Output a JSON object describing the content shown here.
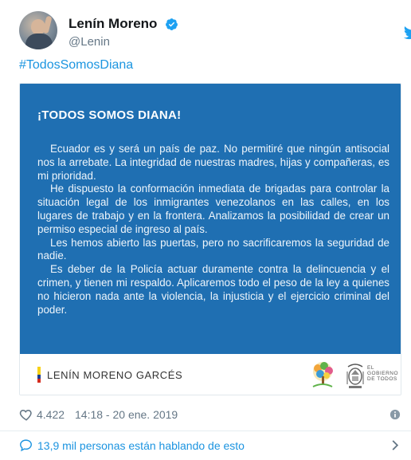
{
  "author": {
    "display_name": "Lenín Moreno",
    "handle": "@Lenin",
    "verified": true
  },
  "tweet": {
    "hashtag": "#TodosSomosDiana"
  },
  "media": {
    "title": "¡TODOS SOMOS DIANA!",
    "paragraphs": [
      "Ecuador es y será un país de paz. No permitiré que ningún antisocial nos la arrebate. La integridad de nuestras madres, hijas y compañeras, es mi prioridad.",
      "He dispuesto la conformación inmediata de brigadas para controlar la situación legal de los inmigrantes venezolanos en las calles, en los lugares de trabajo y en la frontera. Analizamos la posibilidad de crear un permiso especial de ingreso al país.",
      "Les hemos abierto las puertas, pero no sacrificaremos la seguridad de nadie.",
      "Es deber de la Policía actuar duramente contra la delincuencia y el crimen, y tienen mi respaldo. Aplicaremos todo el peso de la ley a quienes no hicieron nada ante la violencia, la injusticia y el ejercicio criminal del poder."
    ],
    "signature": "LENÍN MORENO GARCÉS",
    "government_logo_text": "EL GOBIERNO DE TODOS",
    "panel_color": "#1f6fb2"
  },
  "meta": {
    "likes": "4.422",
    "timestamp": "14:18 - 20 ene. 2019"
  },
  "conversation": {
    "text": "13,9 mil personas están hablando de esto"
  },
  "colors": {
    "link": "#1b95e0",
    "secondary_text": "#657786",
    "flag_yellow": "#f7d117",
    "flag_blue": "#1c3f94",
    "flag_red": "#d52b1e"
  },
  "icons": [
    "verified-icon",
    "twitter-bird-icon",
    "heart-icon",
    "info-icon",
    "chat-bubble-icon",
    "chevron-right-icon"
  ]
}
